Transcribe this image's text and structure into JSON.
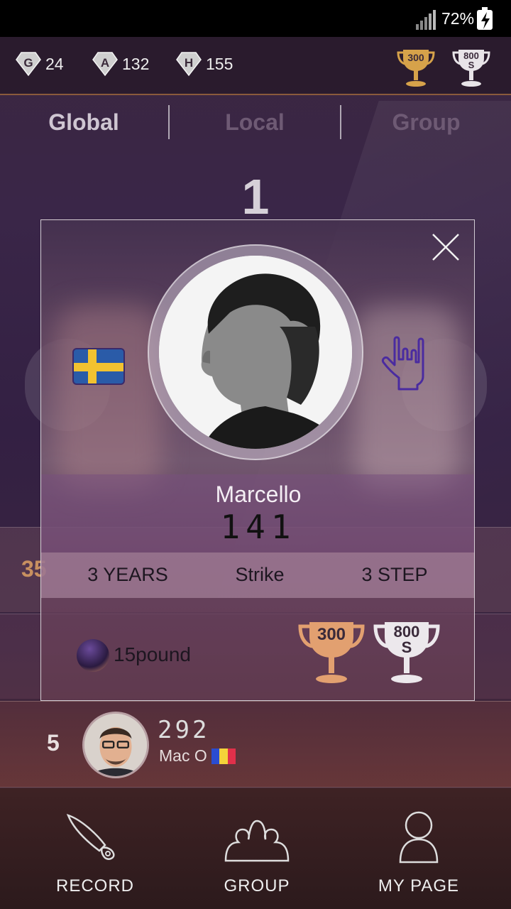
{
  "status_bar": {
    "battery_percent": "72%"
  },
  "top_bar": {
    "stats": [
      {
        "icon": "g-badge-icon",
        "letter": "G",
        "value": "24"
      },
      {
        "icon": "a-badge-icon",
        "letter": "A",
        "value": "132"
      },
      {
        "icon": "h-badge-icon",
        "letter": "H",
        "value": "155"
      }
    ],
    "trophies": [
      {
        "icon": "trophy-300-icon",
        "label": "300",
        "color": "#d6a24a"
      },
      {
        "icon": "trophy-800s-icon",
        "label": "800",
        "sub": "S",
        "color": "#e8e4e8"
      }
    ]
  },
  "tabs": [
    {
      "label": "Global",
      "active": true
    },
    {
      "label": "Local",
      "active": false
    },
    {
      "label": "Group",
      "active": false
    }
  ],
  "leaderboard": {
    "top_rank": "1",
    "partial_rank": "35",
    "row5": {
      "rank": "5",
      "score": "292",
      "name": "Mac O",
      "flag": "romania-flag-icon"
    }
  },
  "profile_popup": {
    "name": "Marcello",
    "score": "141",
    "flag": "sweden-flag-icon",
    "gesture": "rock-hand-icon",
    "experience": "3 YEARS",
    "style": "Strike",
    "approach": "3 STEP",
    "ball": "15pound",
    "trophies": [
      {
        "label": "300",
        "icon": "trophy-300-icon",
        "color": "#e2a070"
      },
      {
        "label": "800",
        "sub": "S",
        "icon": "trophy-800s-icon",
        "color": "#ece8ec"
      }
    ]
  },
  "bottom_nav": [
    {
      "label": "RECORD",
      "icon": "brush-icon"
    },
    {
      "label": "GROUP",
      "icon": "group-icon"
    },
    {
      "label": "MY PAGE",
      "icon": "person-icon"
    }
  ]
}
